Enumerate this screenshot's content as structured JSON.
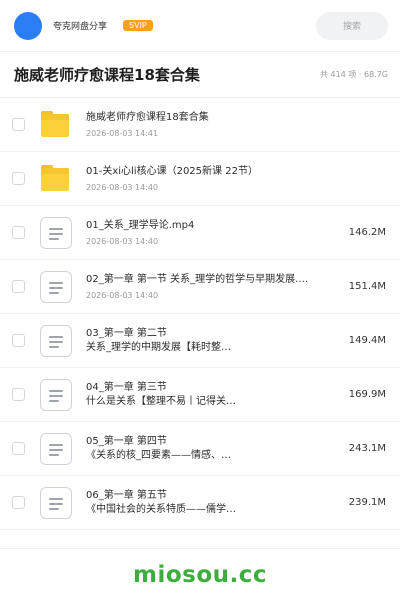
{
  "header": {
    "user_name": "夸克网盘分享",
    "badge": "SVIP",
    "search_placeholder": "搜索"
  },
  "folder": {
    "title": "施威老师疗愈课程18套合集",
    "summary": "共 414 项 · 68.7G"
  },
  "items": [
    {
      "type": "folder",
      "name": "施威老师疗愈课程18套合集",
      "date": "2026-08-03 14:41",
      "size": ""
    },
    {
      "type": "folder",
      "name": "01-关xi心li核心课（2025新课 22节）",
      "date": "2026-08-03 14:40",
      "size": ""
    },
    {
      "type": "file",
      "name": "01_关系_理学导论.mp4",
      "date": "2026-08-03 14:40",
      "size": "146.2M"
    },
    {
      "type": "file",
      "name": "02_第一章 第一节 关系_理学的哲学与早期发展.…",
      "date": "2026-08-03 14:40",
      "size": "151.4M"
    },
    {
      "type": "file",
      "name": "03_第一章 第二节",
      "name2": "关系_理学的中期发展【耗时整…",
      "date": "",
      "size": "149.4M"
    },
    {
      "type": "file",
      "name": "04_第一章 第三节",
      "name2": "什么是关系【整理不易丨记得关…",
      "date": "",
      "size": "169.9M"
    },
    {
      "type": "file",
      "name": "05_第一章 第四节",
      "name2": "《关系的核_四要素——情感、…",
      "date": "",
      "size": "243.1M"
    },
    {
      "type": "file",
      "name": "06_第一章 第五节",
      "name2": "《中国社会的关系特质——儒学…",
      "date": "",
      "size": "239.1M"
    }
  ],
  "watermark": "miosou.cc"
}
